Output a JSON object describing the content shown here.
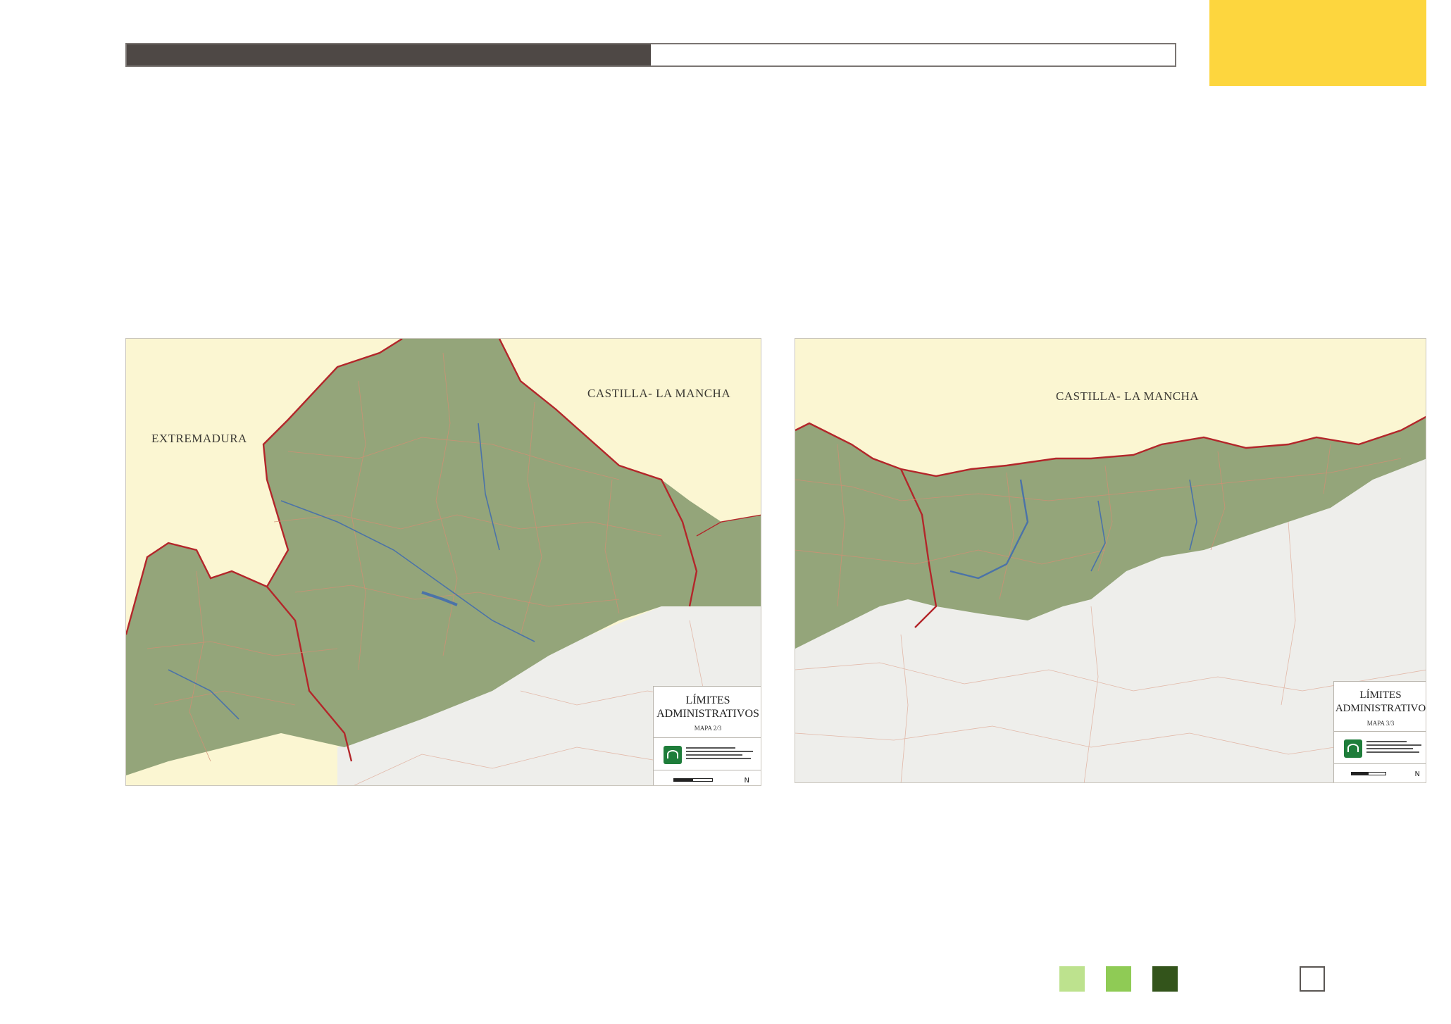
{
  "header": {
    "progress_percent": 50,
    "colors": {
      "bar_fill": "#4e4845",
      "bar_border": "#7a7572",
      "corner_block": "#fdd63e"
    }
  },
  "maps": [
    {
      "regions": [
        "EXTREMADURA",
        "CASTILLA- LA MANCHA"
      ],
      "legend": {
        "title_line1": "LÍMITES",
        "title_line2": "ADMINISTRATIVOS",
        "subtitle": "MAPA 2/3",
        "north": "N"
      }
    },
    {
      "regions": [
        "CASTILLA- LA MANCHA"
      ],
      "legend": {
        "title_line1": "LÍMITES",
        "title_line2": "ADMINISTRATIVO",
        "subtitle": "MAPA 3/3",
        "north": "N"
      }
    }
  ],
  "map_colors": {
    "outside": "#fbf6d2",
    "terrain": "#94a57a",
    "plain": "#eeeeeb",
    "border": "#b3262a",
    "municipal": "#d28f74",
    "river": "#4b73a8"
  },
  "footer_swatches": [
    {
      "name": "light-green",
      "color": "#bde28e"
    },
    {
      "name": "green",
      "color": "#8fcb55"
    },
    {
      "name": "dark-green",
      "color": "#33541b"
    },
    {
      "name": "white",
      "color": "#ffffff"
    }
  ]
}
